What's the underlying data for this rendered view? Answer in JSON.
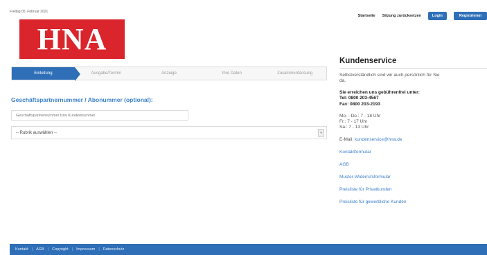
{
  "header": {
    "date": "Freitag 05. Februar 2021",
    "logo_text": "HNA"
  },
  "topnav": {
    "start": "Startseite",
    "session": "Sitzung zurücksetzen",
    "login": "Login",
    "register": "Registrieren"
  },
  "steps": [
    {
      "label": "Einleitung",
      "active": true
    },
    {
      "label": "Ausgabe/Termin",
      "active": false
    },
    {
      "label": "Anzeige",
      "active": false
    },
    {
      "label": "Ihre Daten",
      "active": false
    },
    {
      "label": "Zusammenfassung",
      "active": false
    }
  ],
  "form": {
    "gp_label": "Geschäftspartnernummer / Abonummer (optional):",
    "gp_placeholder": "Geschäftspartnernummer bzw Kundennummer",
    "rubrik_selected": "-- Rubrik auswählen --"
  },
  "sidebar": {
    "title": "Kundenservice",
    "intro": "Selbstverständlich sind wir auch persönlich für Sie da.",
    "reach": "Sie erreichen uns gebührenfrei unter:",
    "tel": "Tel: 0800 203-4567",
    "fax": "Fax: 0800 203-2193",
    "hours": [
      "Mo. - Do.: 7 - 18 Uhr",
      "Fr.: 7 - 17 Uhr",
      "Sa.: 7 - 13 Uhr"
    ],
    "email_label": "E-Mail:",
    "email": "kundenservice@hna.de",
    "links": [
      "Kontaktformular",
      "AGB",
      "Muster-Widerrufsformular",
      "Preisliste für Privatkunden",
      "Preisliste für gewerbliche Kunden"
    ]
  },
  "footer": {
    "items": [
      "Kontakt",
      "AGB",
      "Copyright",
      "Impressum",
      "Datenschutz"
    ]
  },
  "colors": {
    "brand_red": "#d9252b",
    "accent_blue": "#2e6fb7",
    "link_blue": "#3a7fc9"
  }
}
